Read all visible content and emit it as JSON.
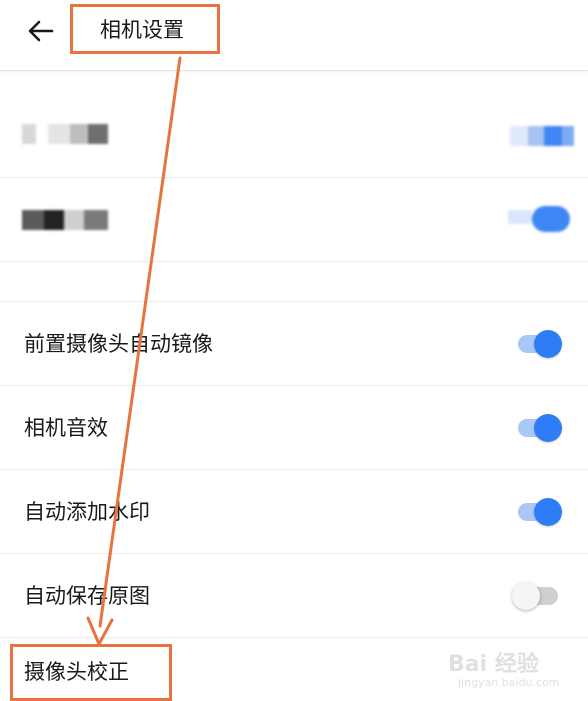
{
  "header": {
    "title": "相机设置",
    "back_icon": "arrow-left-icon"
  },
  "settings": [
    {
      "label": "前置摄像头自动镜像",
      "enabled": true
    },
    {
      "label": "相机音效",
      "enabled": true
    },
    {
      "label": "自动添加水印",
      "enabled": true
    },
    {
      "label": "自动保存原图",
      "enabled": false
    },
    {
      "label": "摄像头校正"
    }
  ],
  "colors": {
    "annotation": "#e8733f",
    "toggle_on": "#2f7df6",
    "toggle_on_track": "#a9c8f5",
    "toggle_off_track": "#cfcfcf"
  },
  "watermark": {
    "logo_text": "Bai 经验",
    "sub_text": "jingyan.baidu.com"
  }
}
